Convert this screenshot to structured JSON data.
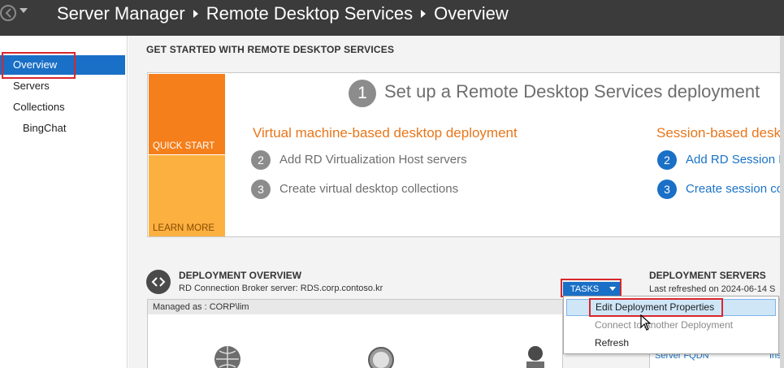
{
  "titlebar": {
    "crumbs": [
      "Server Manager",
      "Remote Desktop Services",
      "Overview"
    ]
  },
  "sidebar": {
    "items": [
      {
        "label": "Overview"
      },
      {
        "label": "Servers"
      },
      {
        "label": "Collections"
      },
      {
        "label": "BingChat"
      }
    ]
  },
  "main": {
    "section_title": "GET STARTED WITH REMOTE DESKTOP SERVICES",
    "tiles": {
      "quick_start": "QUICK START",
      "learn_more": "LEARN MORE"
    },
    "step1": {
      "num": "1",
      "text": "Set up a Remote Desktop Services deployment"
    },
    "vm_col": {
      "heading": "Virtual machine-based desktop deployment",
      "steps": [
        {
          "num": "2",
          "text": "Add RD Virtualization Host servers"
        },
        {
          "num": "3",
          "text": "Create virtual desktop collections"
        }
      ]
    },
    "session_col": {
      "heading": "Session-based desk",
      "steps": [
        {
          "num": "2",
          "text": "Add RD Session H"
        },
        {
          "num": "3",
          "text": "Create session co"
        }
      ]
    },
    "deployment_overview": {
      "title": "DEPLOYMENT OVERVIEW",
      "broker": "RD Connection Broker server: RDS.corp.contoso.kr",
      "managed_as": "Managed as : CORP\\lim"
    },
    "tasks_label": "TASKS",
    "deployment_servers": {
      "title": "DEPLOYMENT SERVERS",
      "refreshed": "Last refreshed on 2024-06-14 S",
      "col_fqdn": "Server FQDN",
      "col_inst": "Inst"
    }
  },
  "menu": {
    "items": [
      "Edit Deployment Properties",
      "Connect to Another Deployment",
      "Refresh"
    ]
  },
  "colors": {
    "titlebar": "#3b3b3b",
    "accent": "#1a6fc6",
    "orange": "#f57f1b",
    "highlight_box": "#d9272e"
  }
}
